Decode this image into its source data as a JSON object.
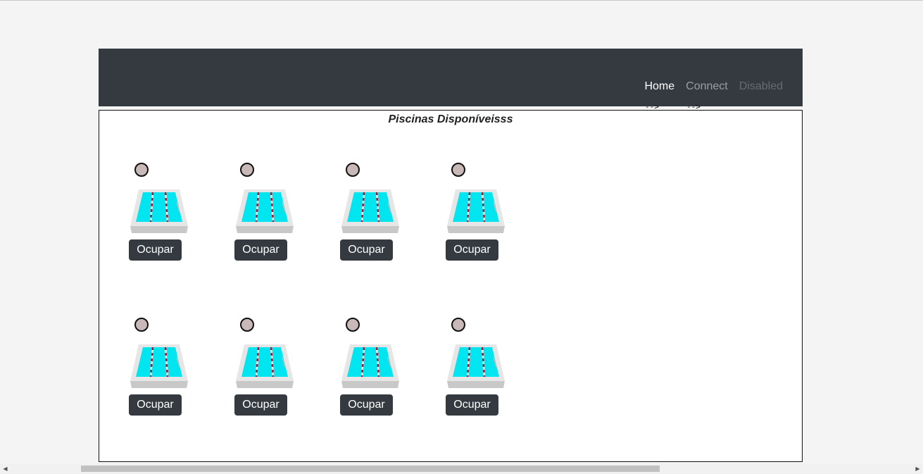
{
  "nav": {
    "items": [
      {
        "label": "Home",
        "state": "active"
      },
      {
        "label": "Connect",
        "state": "normal"
      },
      {
        "label": "Disabled",
        "state": "disabled"
      }
    ],
    "stray_text": [
      "-->",
      "-->"
    ]
  },
  "panel": {
    "title": "Piscinas Disponíveisss"
  },
  "pools": [
    {
      "button_label": "Ocupar"
    },
    {
      "button_label": "Ocupar"
    },
    {
      "button_label": "Ocupar"
    },
    {
      "button_label": "Ocupar"
    },
    {
      "button_label": "Ocupar"
    },
    {
      "button_label": "Ocupar"
    },
    {
      "button_label": "Ocupar"
    },
    {
      "button_label": "Ocupar"
    }
  ],
  "icons": {
    "pool": "swimming-pool-icon",
    "status": "status-dot",
    "scroll_left": "arrow-left-icon",
    "scroll_right": "arrow-right-icon"
  },
  "colors": {
    "navbar": "#343a40",
    "button": "#343a40",
    "status_dot": "#c9b8b8",
    "water": "#00e5f0"
  }
}
